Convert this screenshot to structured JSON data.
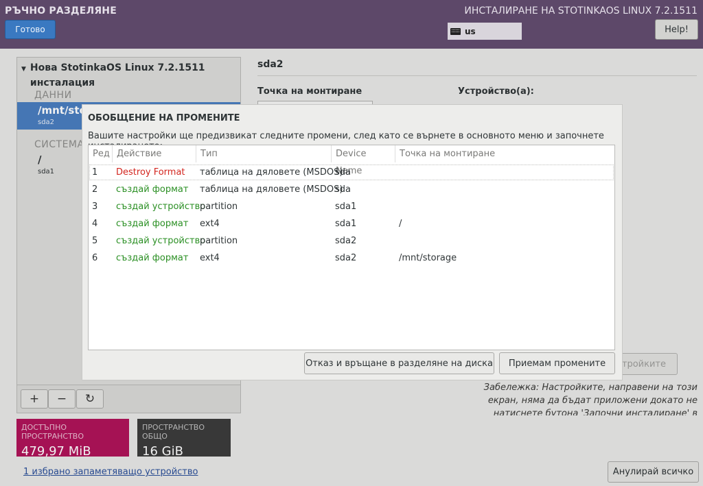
{
  "header": {
    "title": "РЪЧНО РАЗДЕЛЯНЕ",
    "done_label": "Готово",
    "install_title": "ИНСТАЛИРАНЕ НА STOTINKAOS LINUX 7.2.1511",
    "keyboard_layout": "us",
    "help_label": "Help!"
  },
  "left_panel": {
    "install_title": "Нова StotinkaOS Linux 7.2.1511 инсталация",
    "groups": [
      {
        "label": "ДАННИ",
        "items": [
          {
            "mount": "/mnt/storage",
            "device": "sda2",
            "selected": true
          }
        ]
      },
      {
        "label": "СИСТЕМА",
        "items": [
          {
            "mount": "/",
            "device": "sda1",
            "selected": false
          }
        ]
      }
    ],
    "toolbar": {
      "add": "+",
      "remove": "−",
      "refresh": "↻"
    },
    "available_space": {
      "label": "ДОСТЪПНО ПРОСТРАНСТВО",
      "value": "479,97 MiB",
      "color": "#b0145a"
    },
    "total_space": {
      "label": "ПРОСТРАНСТВО ОБЩО",
      "value": "16 GiB",
      "color": "#3c3c3c"
    },
    "storage_link": "1 избрано запаметяващо устройство"
  },
  "right_panel": {
    "device": "sda2",
    "mount_label": "Точка на монтиране",
    "device_label": "Устройство(а):",
    "update_label": "Настройките",
    "note": "Забележка: Настройките, направени на този екран, няма да бъдат приложени докато не натиснете бутона 'Започни инсталиране' в",
    "reset_label": "Анулирай всичко"
  },
  "dialog": {
    "title": "ОБОБЩЕНИЕ НА ПРОМЕНИТЕ",
    "description": "Вашите настройки ще предизвикат следните промени, след като се върнете в основното меню и започнете инсталирането:",
    "columns": {
      "order": "Ред",
      "action": "Действие",
      "type": "Тип",
      "device": "Device Name",
      "mount": "Точка на монтиране"
    },
    "rows": [
      {
        "order": "1",
        "action": "Destroy Format",
        "type": "таблица на дяловете (MSDOS)",
        "device": "sda",
        "mount": "",
        "status": "destroy"
      },
      {
        "order": "2",
        "action": "създай формат",
        "type": "таблица на дяловете (MSDOS)",
        "device": "sda",
        "mount": "",
        "status": "create"
      },
      {
        "order": "3",
        "action": "създай устройство",
        "type": "partition",
        "device": "sda1",
        "mount": "",
        "status": "create"
      },
      {
        "order": "4",
        "action": "създай формат",
        "type": "ext4",
        "device": "sda1",
        "mount": "/",
        "status": "create"
      },
      {
        "order": "5",
        "action": "създай устройство",
        "type": "partition",
        "device": "sda2",
        "mount": "",
        "status": "create"
      },
      {
        "order": "6",
        "action": "създай формат",
        "type": "ext4",
        "device": "sda2",
        "mount": "/mnt/storage",
        "status": "create"
      }
    ],
    "cancel_label": "Отказ и връщане в разделяне на диска",
    "accept_label": "Приемам промените"
  },
  "colors": {
    "header_bg": "#5d4869",
    "accent": "#3a79c1",
    "destroy": "#d3261f",
    "create": "#2a8f23"
  }
}
